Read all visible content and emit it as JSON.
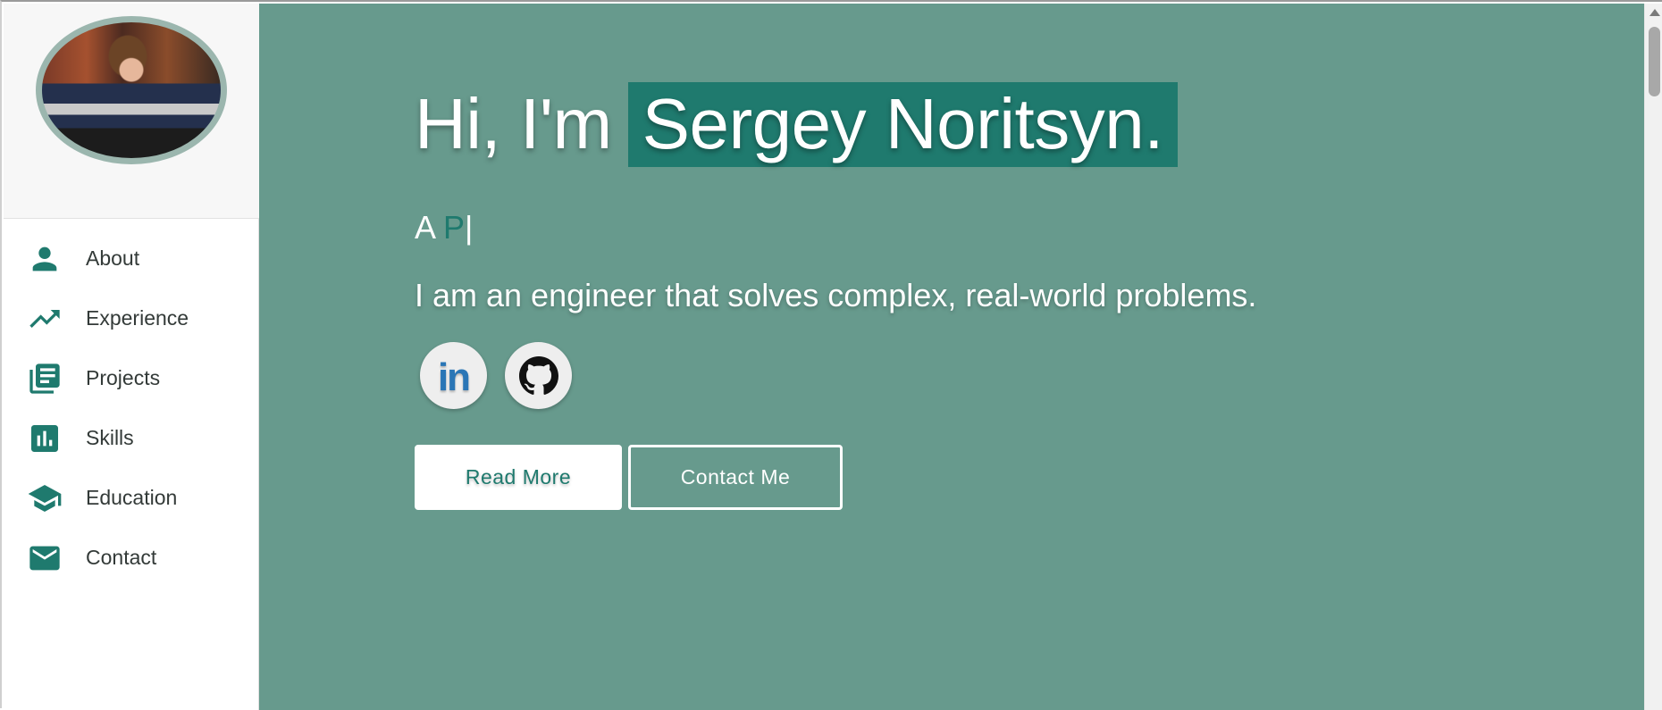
{
  "sidebar": {
    "avatar_alt": "Profile photo",
    "items": [
      {
        "label": "About",
        "icon": "person-icon"
      },
      {
        "label": "Experience",
        "icon": "trending-up-icon"
      },
      {
        "label": "Projects",
        "icon": "library-books-icon"
      },
      {
        "label": "Skills",
        "icon": "bar-chart-icon"
      },
      {
        "label": "Education",
        "icon": "graduation-cap-icon"
      },
      {
        "label": "Contact",
        "icon": "mail-icon"
      }
    ]
  },
  "hero": {
    "greeting": "Hi, I'm",
    "name": "Sergey Noritsyn.",
    "typed_prefix": "A ",
    "typed_text": "P",
    "typed_cursor": "|",
    "tagline": "I am an engineer that solves complex, real-world problems.",
    "social": [
      {
        "name": "LinkedIn",
        "icon": "linkedin-icon",
        "glyph": "in"
      },
      {
        "name": "GitHub",
        "icon": "github-icon"
      }
    ],
    "read_more_label": "Read More",
    "contact_label": "Contact Me"
  },
  "colors": {
    "hero_background": "#679a8d",
    "accent": "#1f7a6e",
    "sidebar_background": "#ffffff",
    "avatar_border": "#9bb6ae",
    "linkedin_blue": "#2a76b6"
  }
}
